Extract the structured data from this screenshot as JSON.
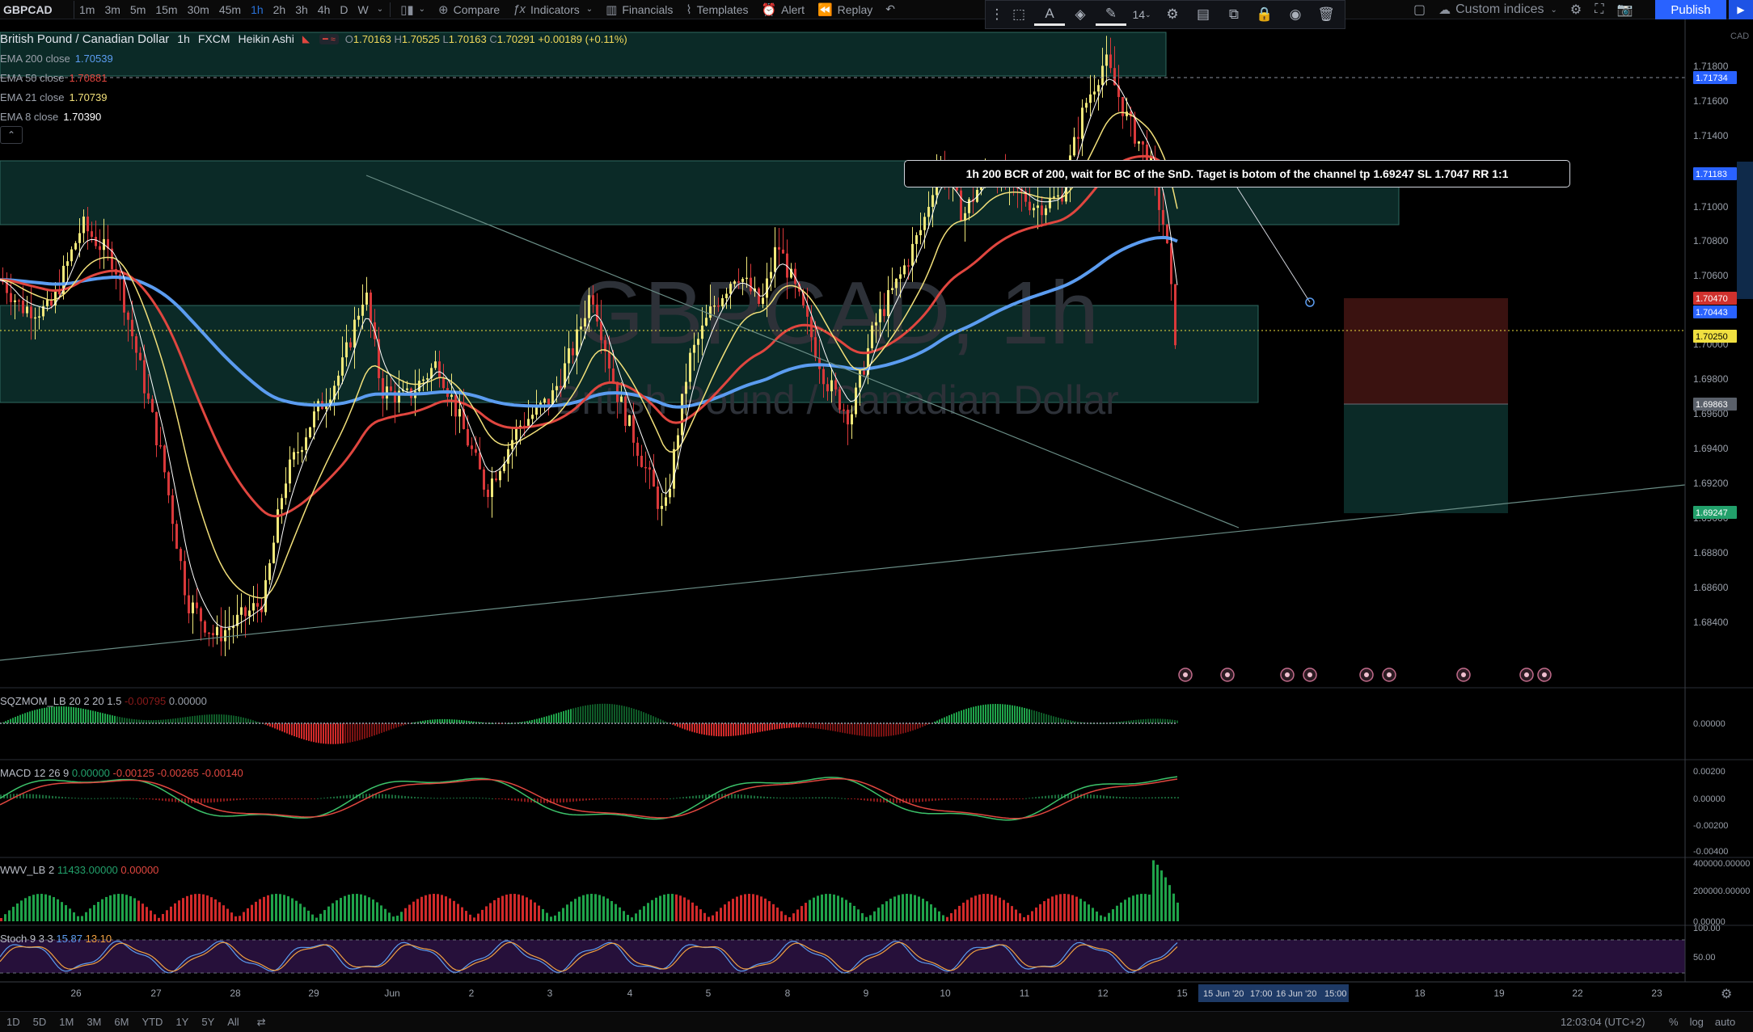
{
  "toolbar": {
    "symbol": "GBPCAD",
    "intervals": [
      "1m",
      "3m",
      "5m",
      "15m",
      "30m",
      "45m",
      "1h",
      "2h",
      "3h",
      "4h",
      "D",
      "W"
    ],
    "active_interval": "1h",
    "compare_label": "Compare",
    "indicators_label": "Indicators",
    "financials_label": "Financials",
    "templates_label": "Templates",
    "alert_label": "Alert",
    "replay_label": "Replay",
    "custom_indices_label": "Custom indices",
    "publish_label": "Publish",
    "font_size": "14"
  },
  "legend": {
    "title": "British Pound / Canadian Dollar",
    "interval": "1h",
    "exchange": "FXCM",
    "style": "Heikin Ashi",
    "ohlc": {
      "o": "1.70163",
      "h": "1.70525",
      "l": "1.70163",
      "c": "1.70291",
      "change": "+0.00189 (+0.11%)"
    },
    "emas": [
      {
        "label": "EMA 200 close",
        "value": "1.70539",
        "color": "#5b9cf0"
      },
      {
        "label": "EMA 50 close",
        "value": "1.70881",
        "color": "#e0463f"
      },
      {
        "label": "EMA 21 close",
        "value": "1.70739",
        "color": "#f2e07a"
      },
      {
        "label": "EMA 8 close",
        "value": "1.70390",
        "color": "#ffffff"
      }
    ],
    "collapse_icon": "chevron-up-icon"
  },
  "watermark": {
    "symbol": "GBPCAD, 1h",
    "name": "British Pound / Canadian Dollar"
  },
  "annotation": "1h 200 BCR of 200, wait for BC of the SnD. Taget is botom of the channel tp 1.69247 SL 1.7047 RR 1:1",
  "price_axis": {
    "currency": "CAD",
    "ticks": [
      "1.71800",
      "1.71600",
      "1.71400",
      "1.71000",
      "1.70800",
      "1.70600",
      "1.70000",
      "1.69800",
      "1.69600",
      "1.69400",
      "1.69200",
      "1.69000",
      "1.68800",
      "1.68600",
      "1.68400"
    ],
    "tags": [
      {
        "value": "1.71734",
        "color": "#2962ff"
      },
      {
        "value": "1.71183",
        "color": "#2962ff"
      },
      {
        "value": "1.70470",
        "color": "#d0312d"
      },
      {
        "value": "1.70443",
        "color": "#2962ff"
      },
      {
        "value": "1.70250",
        "color": "#f0e040",
        "text_color": "#000"
      },
      {
        "value": "1.69863",
        "color": "#5a606a"
      },
      {
        "value": "1.69247",
        "color": "#22a06b"
      }
    ]
  },
  "time_axis": {
    "labels": [
      "26",
      "27",
      "28",
      "29",
      "Jun",
      "2",
      "3",
      "4",
      "5",
      "8",
      "9",
      "10",
      "11",
      "12",
      "15",
      "18",
      "19",
      "22",
      "23"
    ],
    "highlight": [
      "15 Jun '20",
      "17:00",
      "16 Jun '20",
      "15:00"
    ]
  },
  "panes": {
    "sqzmom": {
      "name": "SQZMOM_LB",
      "params": "20 2 20 1.5",
      "v1": "-0.00795",
      "v2": "0.00000",
      "axis": [
        "0.00000"
      ]
    },
    "macd": {
      "name": "MACD",
      "params": "12 26 9",
      "v1": "0.00000",
      "v2": "-0.00125",
      "v3": "-0.00265",
      "v4": "-0.00140",
      "axis": [
        "0.00200",
        "0.00000",
        "-0.00200",
        "-0.00400"
      ]
    },
    "wwv": {
      "name": "WWV_LB",
      "params": "2",
      "v1": "11433.00000",
      "v2": "0.00000",
      "axis": [
        "400000.00000",
        "200000.00000",
        "0.00000"
      ]
    },
    "stoch": {
      "name": "Stoch",
      "params": "9 3 3",
      "v1": "15.87",
      "v2": "13.10",
      "axis": [
        "100.00",
        "50.00"
      ]
    }
  },
  "bottom_bar": {
    "ranges": [
      "1D",
      "5D",
      "1M",
      "3M",
      "6M",
      "YTD",
      "1Y",
      "5Y",
      "All"
    ],
    "clock": "12:03:04 (UTC+2)",
    "scale": [
      "%",
      "log",
      "auto"
    ]
  },
  "chart_data": {
    "type": "candlestick",
    "symbol": "GBPCAD",
    "interval": "1h",
    "candle_style": "Heikin Ashi",
    "y_range": [
      1.6835,
      1.719
    ],
    "zones": [
      {
        "type": "supply",
        "from": 1.7093,
        "to": 1.7112
      },
      {
        "type": "demand",
        "from": 1.6987,
        "to": 1.7046
      },
      {
        "type": "stop",
        "from": 1.6986,
        "to": 1.7049
      },
      {
        "type": "target",
        "from": 1.6924,
        "to": 1.6986
      }
    ],
    "key_levels": {
      "entry": 1.7025,
      "stop_loss": 1.7047,
      "take_profit": 1.69247
    }
  }
}
